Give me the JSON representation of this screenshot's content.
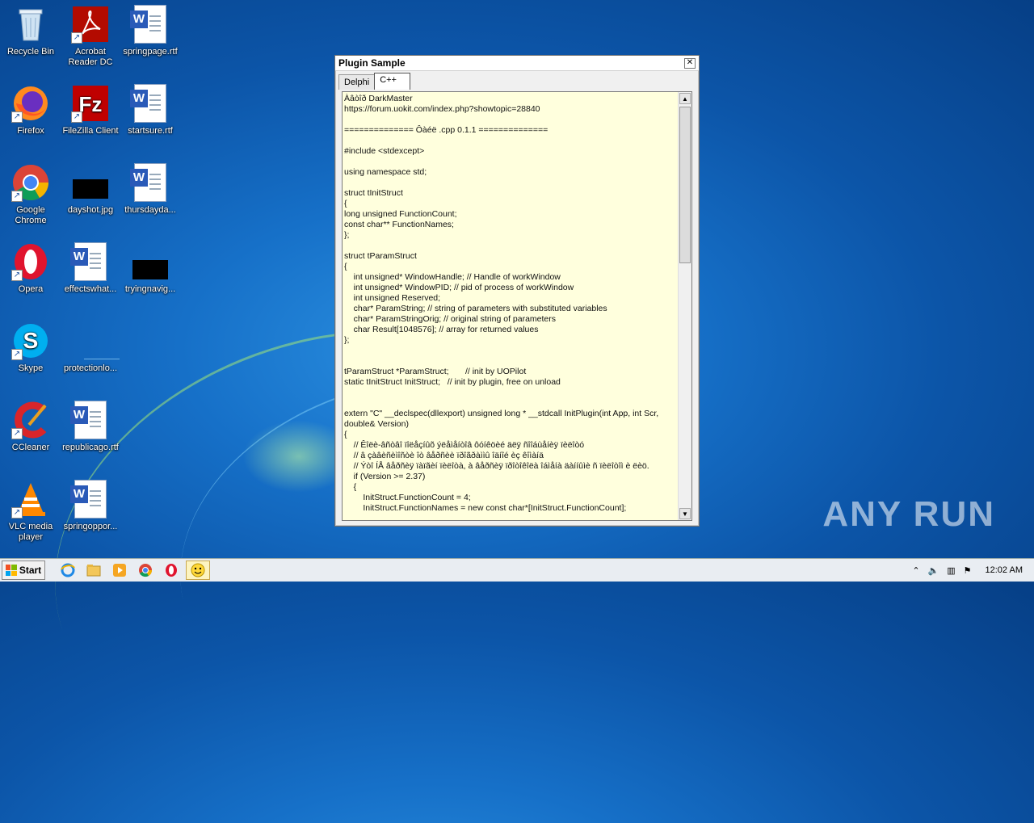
{
  "desktop_icons": [
    {
      "label": "Recycle Bin"
    },
    {
      "label": "Acrobat Reader DC"
    },
    {
      "label": "springpage.rtf"
    },
    {
      "label": "Firefox"
    },
    {
      "label": "FileZilla Client"
    },
    {
      "label": "startsure.rtf"
    },
    {
      "label": "Google Chrome"
    },
    {
      "label": "dayshot.jpg"
    },
    {
      "label": "thursdayda..."
    },
    {
      "label": "Opera"
    },
    {
      "label": "effectswhat..."
    },
    {
      "label": "tryingnavig..."
    },
    {
      "label": "Skype"
    },
    {
      "label": "protectionlo..."
    },
    {
      "label": "CCleaner"
    },
    {
      "label": "republicago.rtf"
    },
    {
      "label": "VLC media player"
    },
    {
      "label": "springoppor..."
    }
  ],
  "window": {
    "title": "Plugin Sample",
    "close_glyph": "✕",
    "tabs": [
      {
        "label": "Delphi"
      },
      {
        "label": "C++"
      }
    ],
    "code_lines": [
      "Àâòîð DarkMaster",
      "https://forum.uokit.com/index.php?showtopic=28840",
      "",
      "============== Ôàéë .cpp 0.1.1 ==============",
      "",
      "#include <stdexcept>",
      "",
      "using namespace std;",
      "",
      "struct tInitStruct",
      "{",
      "long unsigned FunctionCount;",
      "const char** FunctionNames;",
      "};",
      "",
      "struct tParamStruct",
      "{",
      "    int unsigned* WindowHandle; // Handle of workWindow",
      "    int unsigned* WindowPID; // pid of process of workWindow",
      "    int unsigned Reserved;",
      "    char* ParamString; // string of parameters with substituted variables",
      "    char* ParamStringOrig; // original string of parameters",
      "    char Result[1048576]; // array for returned values",
      "};",
      "",
      "",
      "tParamStruct *ParamStruct;       // init by UOPilot",
      "static tInitStruct InitStruct;   // init by plugin, free on unload",
      "",
      "",
      "extern \"C\" __declspec(dllexport) unsigned long * __stdcall InitPlugin(int App, int Scr,",
      "double& Version)",
      "{",
      "    // Êîëè-âñòâî ïîëåçíûõ ýëåìåíòîâ ôóíêöèé äëÿ ñîîáùåíèÿ ïèëîòó",
      "    // â çàâèñèìîñòè îò âåðñèè ïðîãðàììû îäíîé èç êîìàíä",
      "    // Ýòî ÍÅ âåðñèÿ ïàïãèí ïèëîòà, à âåðñèÿ ïðîòîêîëà îáìåíà äàííûìè ñ ïèëîòîì è ëèö.",
      "    if (Version >= 2.37)",
      "    {",
      "        InitStruct.FunctionCount = 4;",
      "        InitStruct.FunctionNames = new const char*[InitStruct.FunctionCount];"
    ]
  },
  "taskbar": {
    "start_label": "Start",
    "clock": "12:02 AM"
  },
  "watermark": "ANY RUN"
}
